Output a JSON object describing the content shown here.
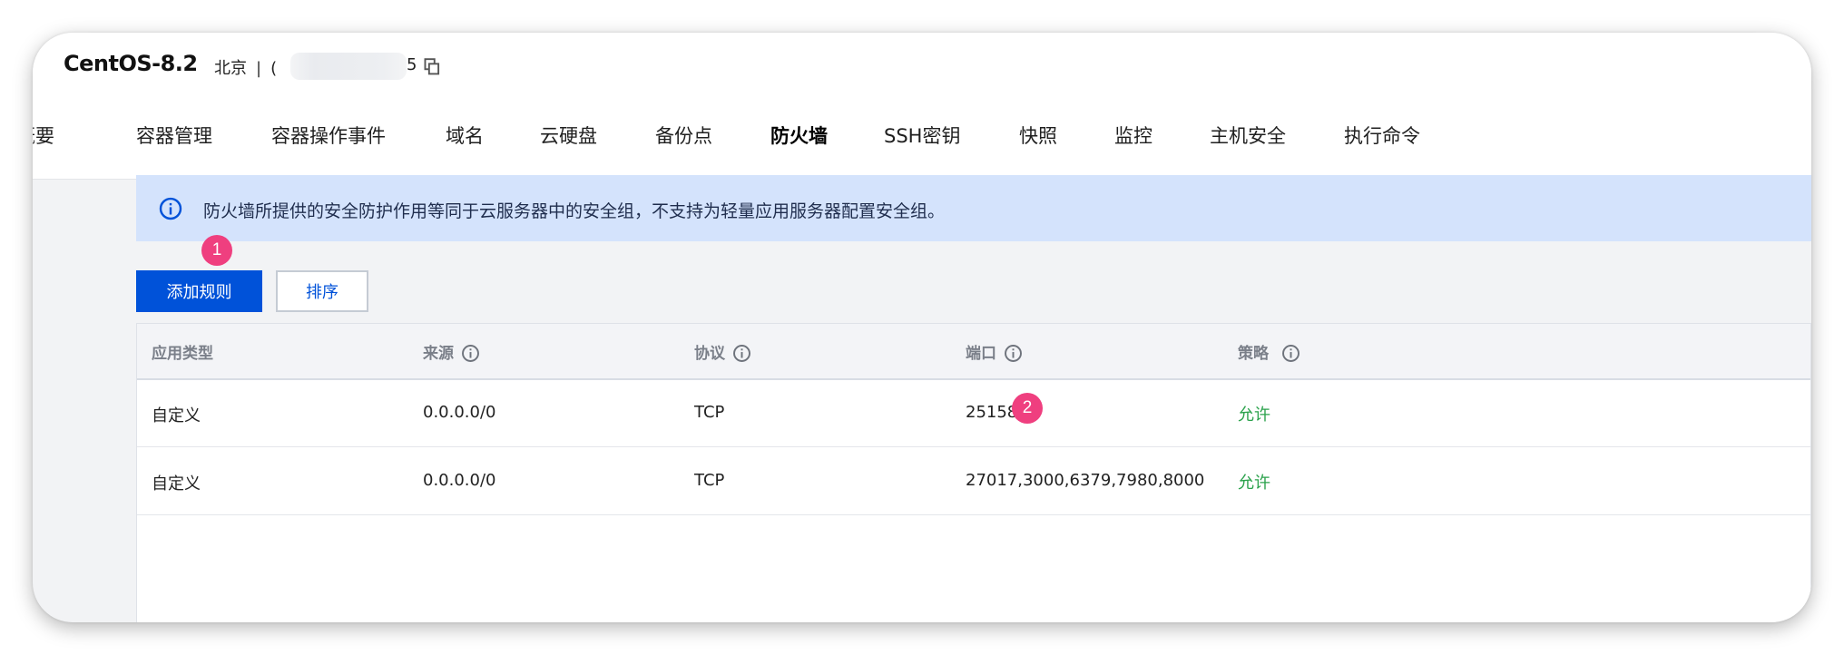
{
  "header": {
    "title": "CentOS-8.2",
    "region": "北京",
    "separator": "|",
    "ip_prefix": "(",
    "ip_suffix": "5"
  },
  "tabs": [
    {
      "label": "概要",
      "active": false
    },
    {
      "label": "容器管理",
      "active": false
    },
    {
      "label": "容器操作事件",
      "active": false
    },
    {
      "label": "域名",
      "active": false
    },
    {
      "label": "云硬盘",
      "active": false
    },
    {
      "label": "备份点",
      "active": false
    },
    {
      "label": "防火墙",
      "active": true
    },
    {
      "label": "SSH密钥",
      "active": false
    },
    {
      "label": "快照",
      "active": false
    },
    {
      "label": "监控",
      "active": false
    },
    {
      "label": "主机安全",
      "active": false
    },
    {
      "label": "执行命令",
      "active": false
    }
  ],
  "notice": {
    "text": "防火墙所提供的安全防护作用等同于云服务器中的安全组，不支持为轻量应用服务器配置安全组。"
  },
  "toolbar": {
    "add_rule_label": "添加规则",
    "sort_label": "排序"
  },
  "annotations": {
    "badge1": "1",
    "badge2": "2"
  },
  "table": {
    "columns": [
      "应用类型",
      "来源",
      "协议",
      "端口",
      "策略"
    ],
    "rows": [
      {
        "type": "自定义",
        "source": "0.0.0.0/0",
        "protocol": "TCP",
        "port": "25158",
        "policy": "允许"
      },
      {
        "type": "自定义",
        "source": "0.0.0.0/0",
        "protocol": "TCP",
        "port": "27017,3000,6379,7980,8000",
        "policy": "允许"
      }
    ]
  },
  "colors": {
    "primary": "#0052d9",
    "notice_bg": "#d4e3fc",
    "badge": "#ef3f7f",
    "allow": "#2ba24c"
  }
}
